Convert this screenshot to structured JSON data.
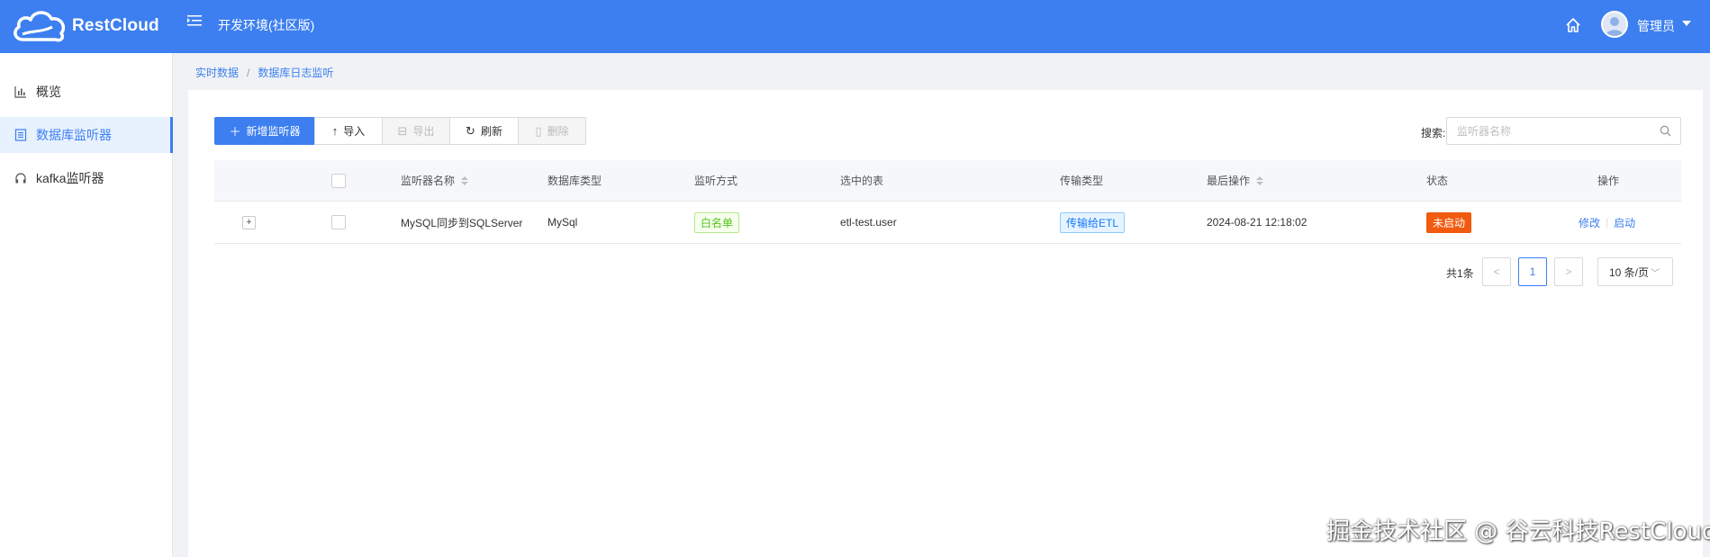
{
  "header": {
    "logo_text": "RestCloud",
    "env_title": "开发环境(社区版)",
    "user_name": "管理员"
  },
  "sidebar": {
    "items": [
      {
        "label": "概览",
        "active": false
      },
      {
        "label": "数据库监听器",
        "active": true
      },
      {
        "label": "kafka监听器",
        "active": false
      }
    ]
  },
  "breadcrumb": {
    "items": [
      "实时数据",
      "数据库日志监听"
    ],
    "separator": "/"
  },
  "toolbar": {
    "add_label": "新增监听器",
    "import_label": "导入",
    "export_label": "导出",
    "refresh_label": "刷新",
    "delete_label": "删除"
  },
  "search": {
    "label": "搜索:",
    "placeholder": "监听器名称"
  },
  "table": {
    "columns": [
      "监听器名称",
      "数据库类型",
      "监听方式",
      "选中的表",
      "传输类型",
      "最后操作",
      "状态",
      "操作"
    ],
    "rows": [
      {
        "name": "MySQL同步到SQLServer",
        "db_type": "MySql",
        "listen_mode": "白名单",
        "tables": "etl-test.user",
        "transfer_type": "传输给ETL",
        "last_op": "2024-08-21 12:18:02",
        "status": "未启动",
        "action_edit": "修改",
        "action_start": "启动"
      }
    ]
  },
  "pagination": {
    "total_text": "共1条",
    "current_page": "1",
    "page_size_text": "10 条/页"
  },
  "watermark": "掘金技术社区 @ 谷云科技RestCloud",
  "colors": {
    "brand": "#3d7ff0",
    "status_stopped": "#f15a0f",
    "tag_green": "#52c41a",
    "tag_blue": "#1677ff"
  }
}
